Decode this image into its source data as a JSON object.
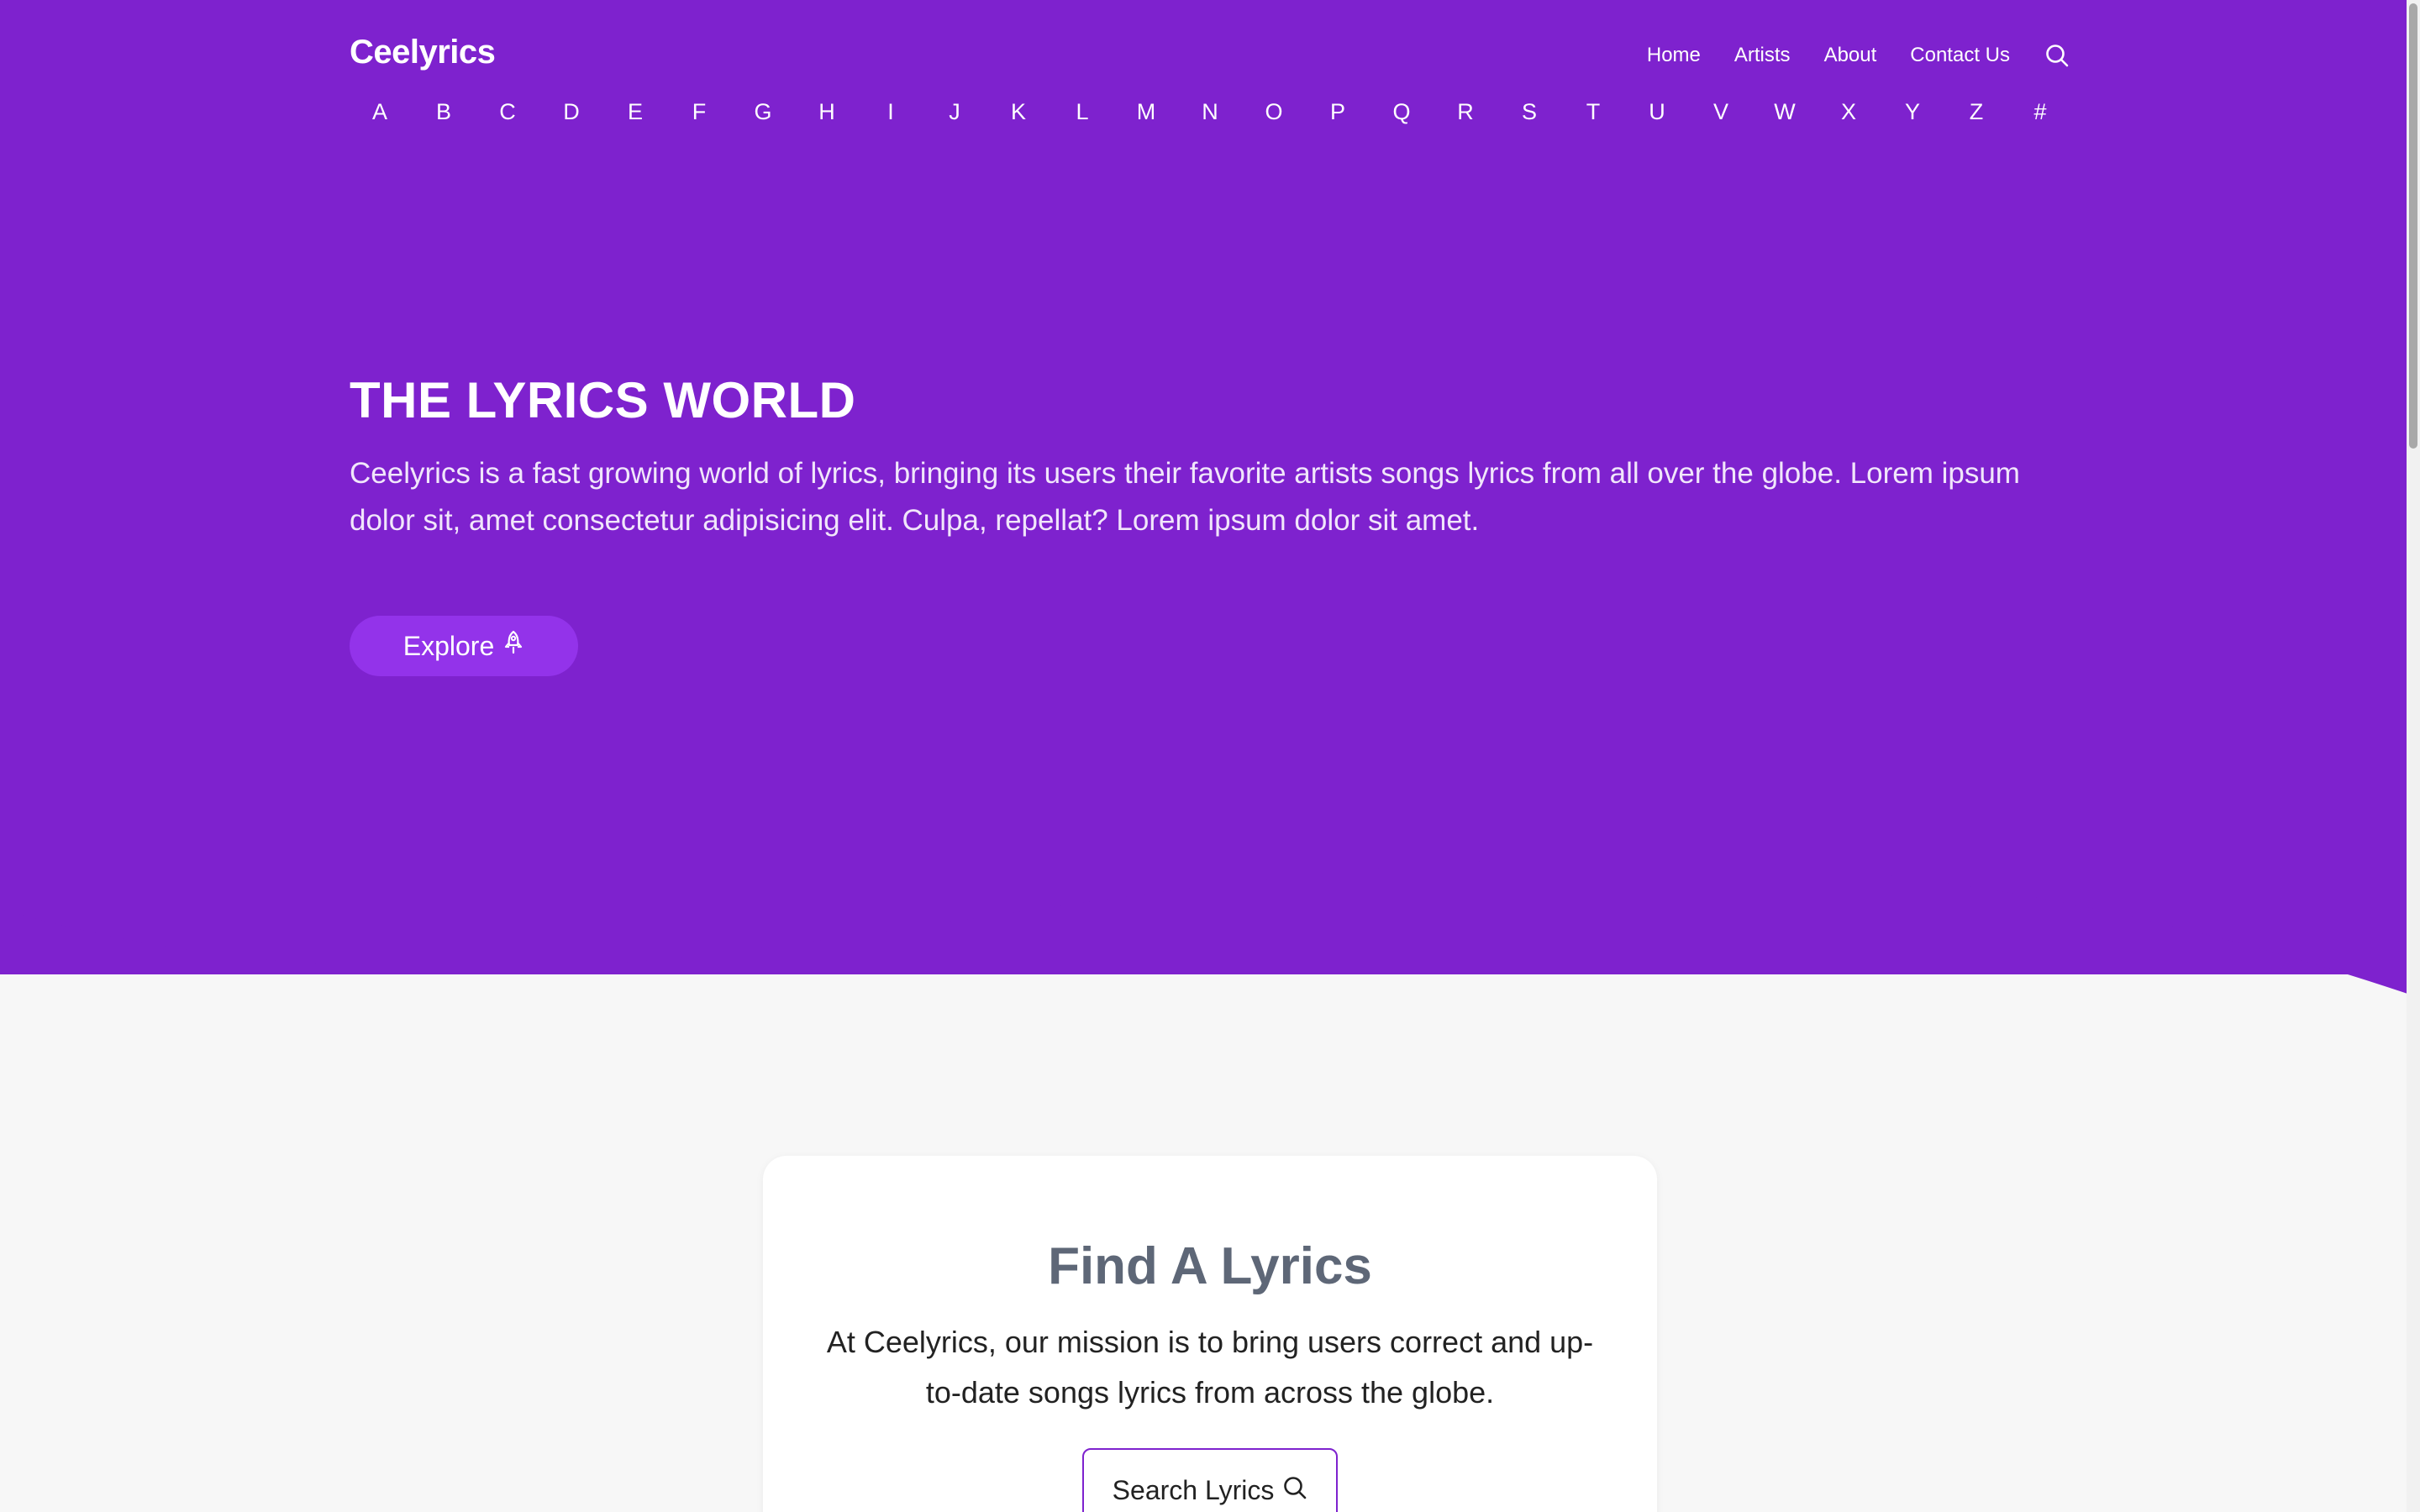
{
  "brand": {
    "name": "Ceelyrics",
    "primary_color": "#7e22ce",
    "button_color": "#9333ea"
  },
  "nav": {
    "links": [
      "Home",
      "Artists",
      "About",
      "Contact Us"
    ],
    "search_icon": "search-icon"
  },
  "alphabet": [
    "A",
    "B",
    "C",
    "D",
    "E",
    "F",
    "G",
    "H",
    "I",
    "J",
    "K",
    "L",
    "M",
    "N",
    "O",
    "P",
    "Q",
    "R",
    "S",
    "T",
    "U",
    "V",
    "W",
    "X",
    "Y",
    "Z",
    "#"
  ],
  "hero": {
    "title": "THE LYRICS WORLD",
    "description": "Ceelyrics is a fast growing world of lyrics, bringing its users their favorite artists songs lyrics from all over the globe. Lorem ipsum dolor sit, amet consectetur adipisicing elit. Culpa, repellat? Lorem ipsum dolor sit amet.",
    "explore_label": "Explore",
    "explore_icon": "rocket-icon"
  },
  "find_card": {
    "title": "Find A Lyrics",
    "description": "At Ceelyrics, our mission is to bring users correct and up-to-date songs lyrics from across the globe.",
    "search_label": "Search Lyrics",
    "search_icon": "search-icon"
  }
}
